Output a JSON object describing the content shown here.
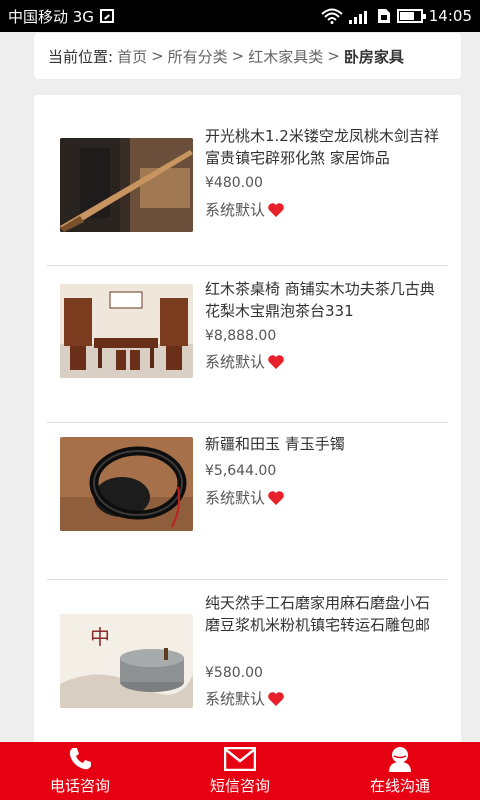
{
  "status_bar": {
    "carrier": "中国移动 3G",
    "network_label": "3G",
    "time": "14:05"
  },
  "breadcrumb": {
    "prefix": "当前位置:",
    "items": [
      "首页",
      "所有分类",
      "红木家具类",
      "卧房家具"
    ],
    "separator": ">"
  },
  "products": [
    {
      "title": "开光桃木1.2米镂空龙凤桃木剑吉祥富贵镇宅辟邪化煞 家居饰品",
      "price": "¥480.00",
      "sort_label": "系统默认",
      "icon": "heart-icon"
    },
    {
      "title": "红木茶桌椅 商铺实木功夫茶几古典花梨木宝鼎泡茶台331",
      "price": "¥8,888.00",
      "sort_label": "系统默认",
      "icon": "heart-icon"
    },
    {
      "title": "新疆和田玉 青玉手镯",
      "price": "¥5,644.00",
      "sort_label": "系统默认",
      "icon": "heart-icon"
    },
    {
      "title": "纯天然手工石磨家用麻石磨盘小石磨豆浆机米粉机镇宅转运石雕包邮",
      "price": "¥580.00",
      "sort_label": "系统默认",
      "icon": "heart-icon"
    }
  ],
  "bottom_nav": [
    {
      "label": "电话咨询",
      "icon": "phone-icon"
    },
    {
      "label": "短信咨询",
      "icon": "envelope-icon"
    },
    {
      "label": "在线沟通",
      "icon": "chat-person-icon"
    }
  ],
  "colors": {
    "accent": "#e60012",
    "heart": "#e8202a"
  }
}
